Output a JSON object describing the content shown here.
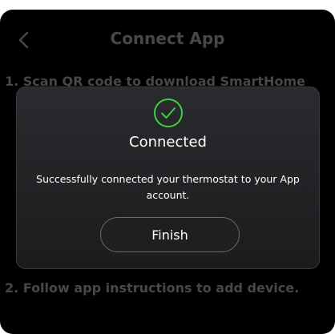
{
  "header": {
    "title": "Connect App",
    "back_icon": "chevron-left-icon"
  },
  "steps": [
    {
      "text": "1. Scan QR code to download SmartHome"
    },
    {
      "text": "2. Follow app instructions to add device."
    }
  ],
  "dialog": {
    "icon": "check-circle-icon",
    "title": "Connected",
    "message": "Successfully connected your thermostat to your App account.",
    "button_label": "Finish"
  },
  "colors": {
    "accent": "#3ecf3e",
    "background": "#000000",
    "dialog": "#232427"
  }
}
